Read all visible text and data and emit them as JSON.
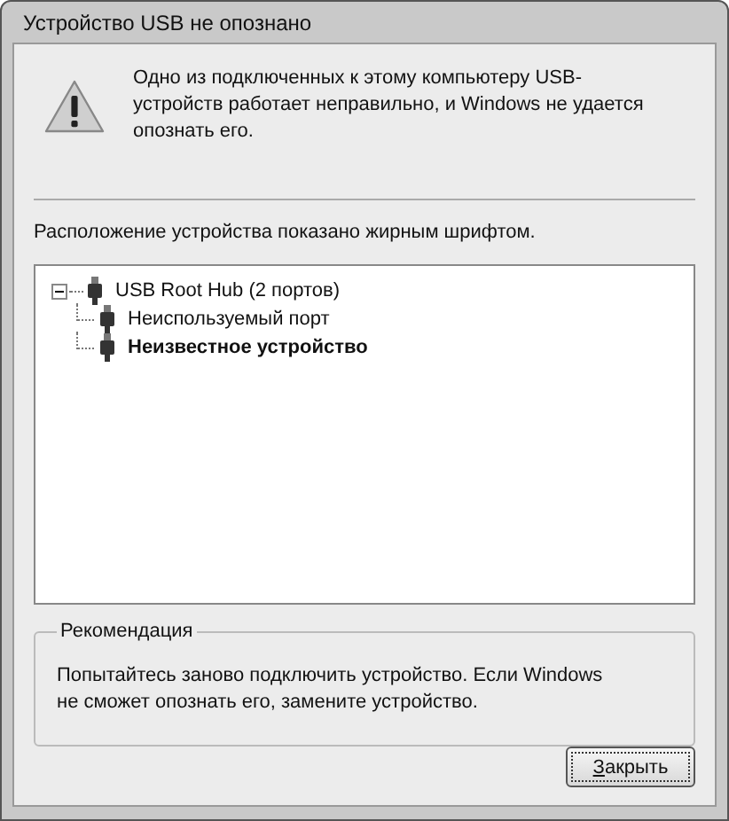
{
  "window": {
    "title": "Устройство USB не опознано"
  },
  "message": {
    "text": "Одно из подключенных к этому компьютеру USB-устройств работает неправильно, и Windows не удается опознать его."
  },
  "hint": "Расположение устройства показано жирным шрифтом.",
  "tree": [
    {
      "label": "USB Root Hub (2 портов)",
      "expanded": true,
      "located": false,
      "children": [
        {
          "label": "Неиспользуемый порт",
          "located": false
        },
        {
          "label": "Неизвестное устройство",
          "located": true
        }
      ]
    }
  ],
  "recommendation": {
    "title": "Рекомендация",
    "text": "Попытайтесь заново подключить устройство. Если Windows не сможет опознать его, замените устройство."
  },
  "buttons": [
    {
      "label": "Закрыть",
      "default": true
    }
  ]
}
